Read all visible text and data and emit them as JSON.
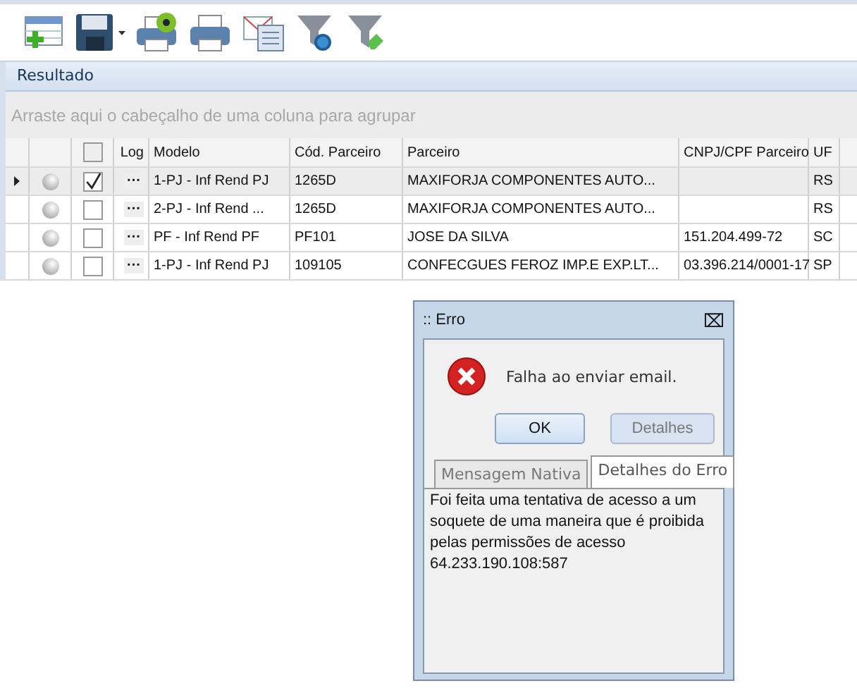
{
  "toolbar": {
    "buttons": [
      {
        "kind": "new-sheet"
      },
      {
        "kind": "save",
        "dropdown": true
      },
      {
        "kind": "print-help"
      },
      {
        "kind": "print"
      },
      {
        "kind": "mail"
      },
      {
        "kind": "filter-gear"
      },
      {
        "kind": "filter-clear"
      }
    ]
  },
  "panel": {
    "title": "Resultado",
    "group_hint": "Arraste aqui o cabeçalho de uma coluna para agrupar"
  },
  "table": {
    "columns": [
      "Log",
      "Modelo",
      "Cód. Parceiro",
      "Parceiro",
      "CNPJ/CPF Parceiro",
      "UF"
    ],
    "header_checked": false,
    "rows": [
      {
        "selected": true,
        "checked": true,
        "log": "···",
        "modelo": "1-PJ - Inf Rend PJ",
        "codigo": "1265D",
        "parceiro": "MAXIFORJA COMPONENTES AUTO...",
        "cnpj": "",
        "uf": "RS"
      },
      {
        "selected": false,
        "checked": false,
        "log": "···",
        "modelo": "2-PJ - Inf Rend ...",
        "codigo": "1265D",
        "parceiro": "MAXIFORJA COMPONENTES AUTO...",
        "cnpj": "",
        "uf": "RS"
      },
      {
        "selected": false,
        "checked": false,
        "log": "···",
        "modelo": "PF - Inf Rend PF",
        "codigo": "PF101",
        "parceiro": "JOSE DA SILVA",
        "cnpj": "151.204.499-72",
        "uf": "SC"
      },
      {
        "selected": false,
        "checked": false,
        "log": "···",
        "modelo": "1-PJ - Inf Rend PJ",
        "codigo": "109105",
        "parceiro": "CONFECGUES FEROZ IMP.E EXP.LT...",
        "cnpj": "03.396.214/0001-17",
        "uf": "SP"
      }
    ]
  },
  "dialog": {
    "title": ":: Erro",
    "close": "⌧",
    "message": "Falha ao enviar email.",
    "buttons": [
      {
        "label": "OK",
        "disabled": false
      },
      {
        "label": "Detalhes",
        "disabled": true
      }
    ],
    "tabs": [
      {
        "label": "Mensagem Nativa",
        "selected": false
      },
      {
        "label": "Detalhes do Erro",
        "selected": true
      }
    ],
    "details": "Foi feita uma tentativa de acesso a um soquete de uma maneira que é proibida pelas permissões de acesso 64.233.190.108:587"
  }
}
